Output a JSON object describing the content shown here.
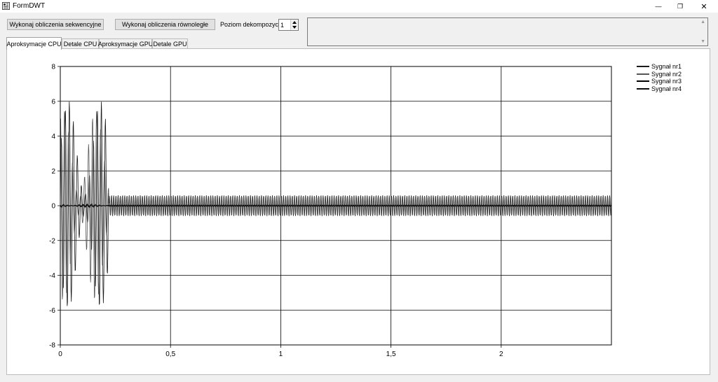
{
  "window": {
    "title": "FormDWT",
    "controls": {
      "minimize": "—",
      "restore": "❐",
      "close": "✕"
    }
  },
  "toolbar": {
    "sequential_label": "Wykonaj obliczenia sekwencyjne",
    "parallel_label": "Wykonaj obliczenia równoległe",
    "level_label": "Poziom dekompozycji",
    "level_value": "1"
  },
  "tabs": [
    {
      "label": "Aproksymacje CPU",
      "active": true
    },
    {
      "label": "Detale CPU",
      "active": false
    },
    {
      "label": "Aproksymacje GPU",
      "active": false
    },
    {
      "label": "Detale GPU",
      "active": false
    }
  ],
  "chart_data": {
    "type": "line",
    "xlim": [
      0,
      2.5
    ],
    "ylim": [
      -8,
      8
    ],
    "x_ticks": [
      0,
      0.5,
      1,
      1.5,
      2
    ],
    "x_tick_labels": [
      "0",
      "0,5",
      "1",
      "1,5",
      "2"
    ],
    "y_ticks": [
      -8,
      -6,
      -4,
      -2,
      0,
      2,
      4,
      6,
      8
    ],
    "y_tick_labels": [
      "-8",
      "-6",
      "-4",
      "-2",
      "0",
      "2",
      "4",
      "6",
      "8"
    ],
    "grid": true,
    "legend_position": "top-right",
    "series": [
      {
        "name": "Sygnał nr1",
        "color": "#1a1a1a",
        "burst_end": 0.22,
        "burst_amplitude": 6.0,
        "steady_amplitude": 0.6,
        "offset": 0.05
      },
      {
        "name": "Sygnał nr2",
        "color": "#555555",
        "burst_end": 0.22,
        "burst_amplitude": 5.5,
        "steady_amplitude": 0.55,
        "offset": 0.0
      },
      {
        "name": "Sygnał nr3",
        "color": "#000000",
        "burst_end": 0.22,
        "burst_amplitude": 0.1,
        "steady_amplitude": 0.05,
        "offset": 0.0
      },
      {
        "name": "Sygnał nr4",
        "color": "#0a0a0a",
        "burst_end": 0.22,
        "burst_amplitude": 0.08,
        "steady_amplitude": 0.04,
        "offset": 0.0
      }
    ]
  }
}
